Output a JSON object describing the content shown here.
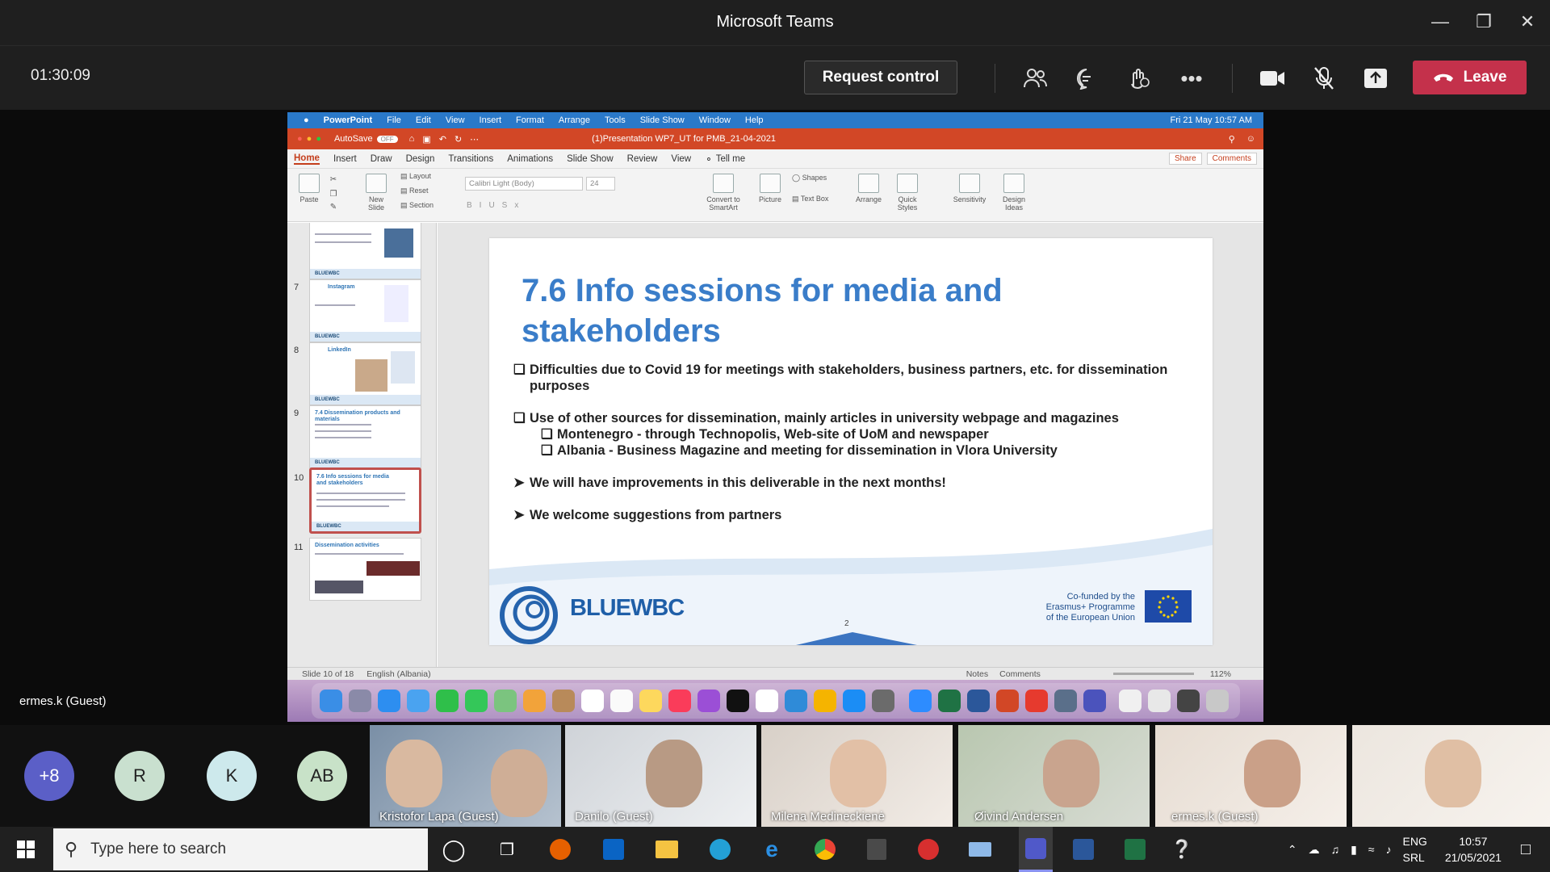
{
  "window": {
    "title": "Microsoft Teams"
  },
  "meeting": {
    "timer": "01:30:09",
    "request_control": "Request control",
    "leave": "Leave"
  },
  "mac_menu": {
    "app": "PowerPoint",
    "items": [
      "File",
      "Edit",
      "View",
      "Insert",
      "Format",
      "Arrange",
      "Tools",
      "Slide Show",
      "Window",
      "Help"
    ],
    "clock": "Fri 21 May  10:57 AM"
  },
  "ppt": {
    "autosave": "AutoSave",
    "autosave_state": "OFF",
    "doc_title": "(1)Presentation WP7_UT for PMB_21-04-2021",
    "tabs": [
      "Home",
      "Insert",
      "Draw",
      "Design",
      "Transitions",
      "Animations",
      "Slide Show",
      "Review",
      "View"
    ],
    "tell_me": "Tell me",
    "share": "Share",
    "comments": "Comments",
    "ribbon": {
      "paste": "Paste",
      "new_slide": "New Slide",
      "layout": "Layout",
      "reset": "Reset",
      "section": "Section",
      "font": "Calibri Light (Body)",
      "size": "24",
      "convert": "Convert to SmartArt",
      "picture": "Picture",
      "shapes": "Shapes",
      "textbox": "Text Box",
      "arrange": "Arrange",
      "quick_styles": "Quick Styles",
      "sensitivity": "Sensitivity",
      "design_ideas": "Design Ideas"
    },
    "thumbnails": [
      {
        "num": "",
        "title": ""
      },
      {
        "num": "7",
        "title": "Instagram"
      },
      {
        "num": "8",
        "title": "LinkedIn"
      },
      {
        "num": "9",
        "title": "7.4 Dissemination products and materials"
      },
      {
        "num": "10",
        "title": "7.6 Info sessions for media and stakeholders"
      },
      {
        "num": "11",
        "title": "Dissemination activities"
      }
    ],
    "thumb_brand": "BLUEWBC",
    "status": {
      "slide": "Slide 10 of 18",
      "lang": "English (Albania)",
      "notes": "Notes",
      "comments": "Comments",
      "zoom": "112%"
    }
  },
  "slide": {
    "title_line1": "7.6 Info sessions for media and",
    "title_line2": "stakeholders",
    "b1_l1": "Difficulties due to Covid 19 for meetings with stakeholders, business partners, etc. for dissemination",
    "b1_l2": "purposes",
    "b2": "Use of other sources for dissemination, mainly articles in university webpage and magazines",
    "b2a": "Montenegro -  through Technopolis, Web-site of UoM and newspaper",
    "b2b": "Albania - Business Magazine and meeting for dissemination in Vlora University",
    "b3": "We will have improvements in this deliverable in the next months!",
    "b4": "We welcome suggestions from partners",
    "brand": "BLUEWBC",
    "cofund_l1": "Co-funded by the",
    "cofund_l2": "Erasmus+ Programme",
    "cofund_l3": "of the European Union",
    "page": "2"
  },
  "presenter_label": "ermes.k (Guest)",
  "avatars": [
    {
      "label": "+8",
      "color": "#5b5fc7"
    },
    {
      "label": "R",
      "color": "#c9e0cf"
    },
    {
      "label": "K",
      "color": "#cde9ec"
    },
    {
      "label": "AB",
      "color": "#c8e2c8"
    }
  ],
  "participants": [
    {
      "name": "Kristofor Lapa (Guest)"
    },
    {
      "name": "Danilo (Guest)"
    },
    {
      "name": "Milena Medineckienė"
    },
    {
      "name": "Øivind Andersen"
    },
    {
      "name": "ermes.k (Guest)"
    },
    {
      "name": ""
    }
  ],
  "taskbar": {
    "search_placeholder": "Type here to search",
    "lang1": "ENG",
    "lang2": "SRL",
    "time": "10:57",
    "date": "21/05/2021"
  }
}
